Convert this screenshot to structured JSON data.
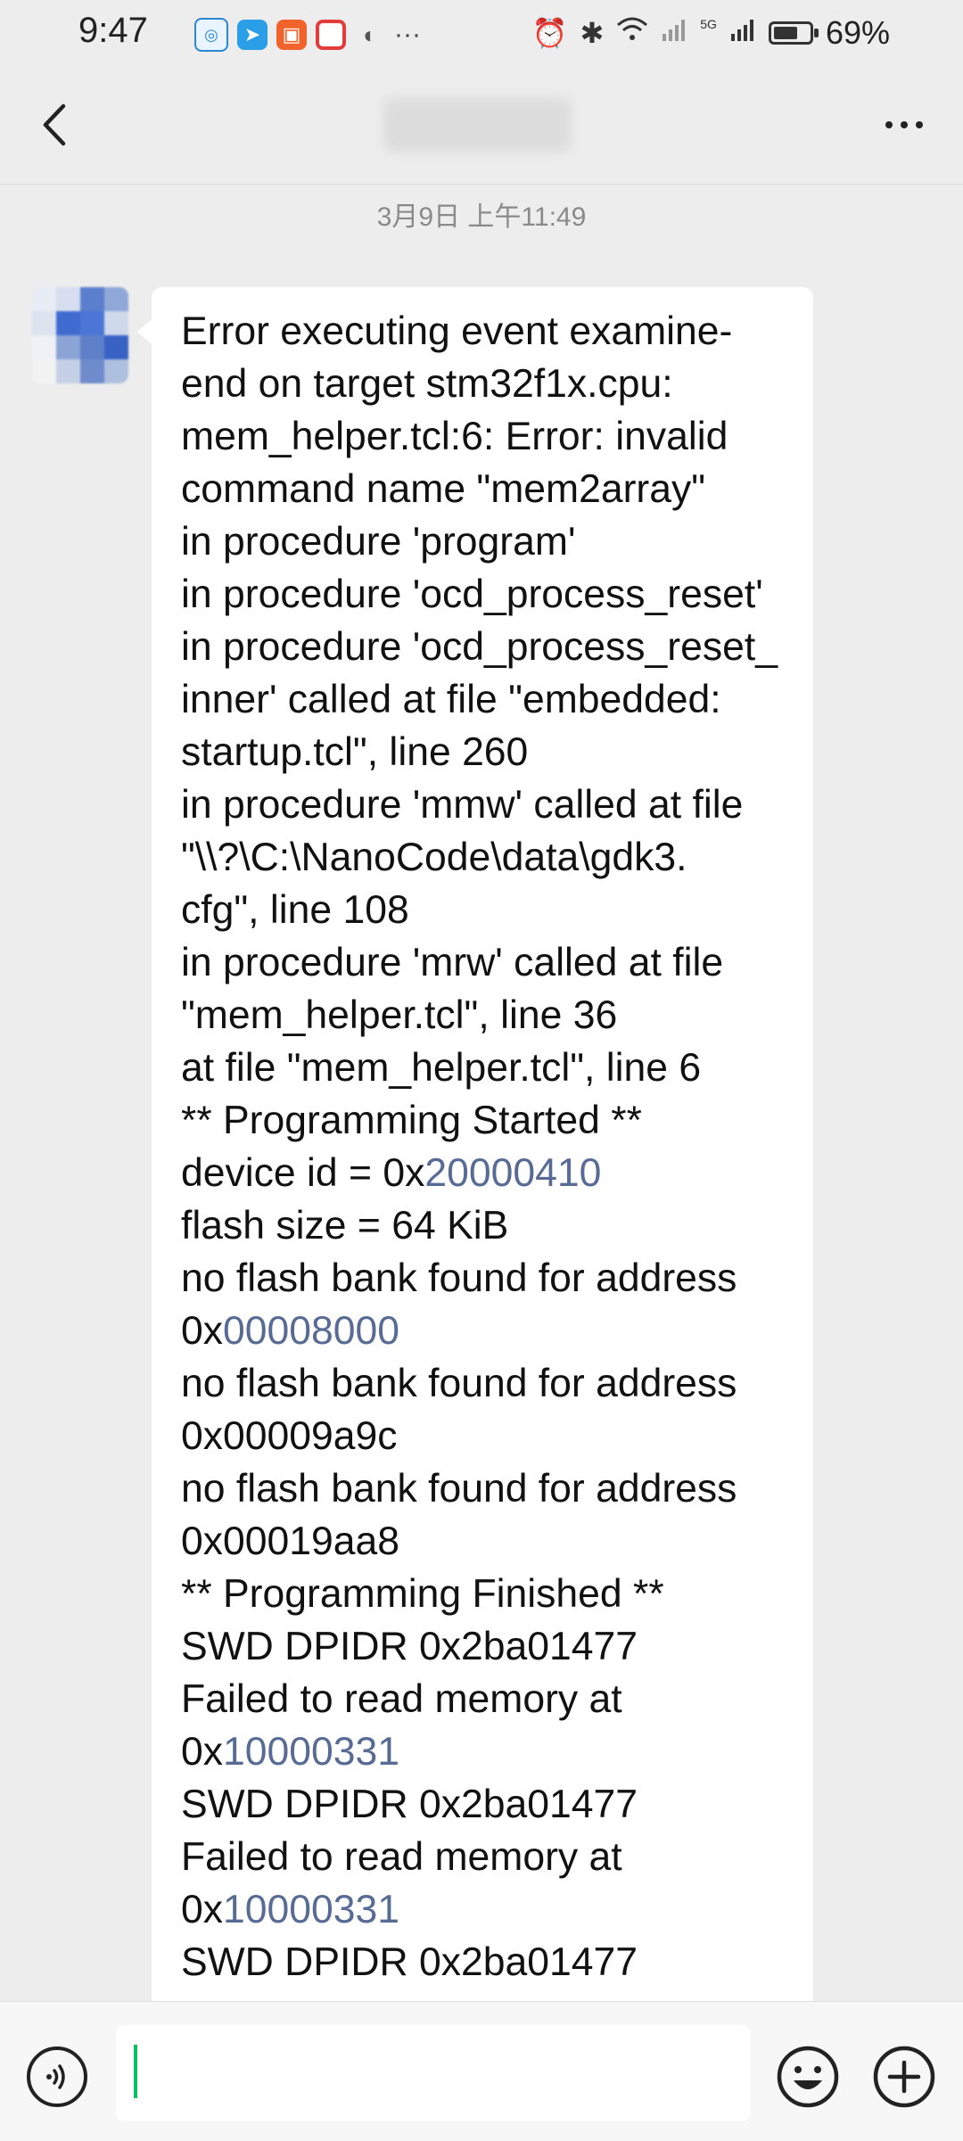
{
  "status_bar": {
    "time": "9:47",
    "notification_icons": [
      "chat-app-icon",
      "telegram-icon",
      "shop-app-icon",
      "red-app-icon",
      "wechat-icon"
    ],
    "overflow": "···",
    "network": "5G",
    "battery_percent": "69%",
    "battery_level": 0.69
  },
  "header": {
    "title": "",
    "back_icon": "back-chevron-icon",
    "more_icon": "more-dots-icon"
  },
  "conversation": {
    "timestamp": "3月9日 上午11:49",
    "message_lines": [
      [
        {
          "t": "Error executing event examine-"
        }
      ],
      [
        {
          "t": "end on target stm32f1x.cpu:"
        }
      ],
      [
        {
          "t": "mem_helper.tcl:6: Error: invalid"
        }
      ],
      [
        {
          "t": "command name \"mem2array\""
        }
      ],
      [
        {
          "t": "in procedure 'program'"
        }
      ],
      [
        {
          "t": "in procedure 'ocd_process_reset'"
        }
      ],
      [
        {
          "t": "in procedure 'ocd_process_reset_"
        }
      ],
      [
        {
          "t": "inner' called at file \"embedded:"
        }
      ],
      [
        {
          "t": "startup.tcl\", line 260"
        }
      ],
      [
        {
          "t": "in procedure 'mmw' called at file"
        }
      ],
      [
        {
          "t": "\"\\\\?\\C:\\NanoCode\\data\\gdk3."
        }
      ],
      [
        {
          "t": "cfg\", line 108"
        }
      ],
      [
        {
          "t": "in procedure 'mrw' called at file"
        }
      ],
      [
        {
          "t": "\"mem_helper.tcl\", line 36"
        }
      ],
      [
        {
          "t": "at file \"mem_helper.tcl\", line 6"
        }
      ],
      [
        {
          "t": "** Programming Started **"
        }
      ],
      [
        {
          "t": "device id = 0x"
        },
        {
          "t": "20000410",
          "link": true
        }
      ],
      [
        {
          "t": "flash size = 64 KiB"
        }
      ],
      [
        {
          "t": "no flash bank found for address"
        }
      ],
      [
        {
          "t": "0x"
        },
        {
          "t": "00008000",
          "link": true
        }
      ],
      [
        {
          "t": "no flash bank found for address"
        }
      ],
      [
        {
          "t": "0x00009a9c"
        }
      ],
      [
        {
          "t": "no flash bank found for address"
        }
      ],
      [
        {
          "t": "0x00019aa8"
        }
      ],
      [
        {
          "t": "** Programming Finished **"
        }
      ],
      [
        {
          "t": "SWD DPIDR 0x2ba01477"
        }
      ],
      [
        {
          "t": "Failed to read memory at"
        }
      ],
      [
        {
          "t": "0x"
        },
        {
          "t": "10000331",
          "link": true
        }
      ],
      [
        {
          "t": "SWD DPIDR 0x2ba01477"
        }
      ],
      [
        {
          "t": "Failed to read memory at"
        }
      ],
      [
        {
          "t": "0x"
        },
        {
          "t": "10000331",
          "link": true
        }
      ],
      [
        {
          "t": "SWD DPIDR 0x2ba01477"
        }
      ]
    ]
  },
  "input_bar": {
    "placeholder": "",
    "voice_icon": "voice-input-icon",
    "emoji_icon": "emoji-icon",
    "plus_icon": "plus-icon"
  },
  "colors": {
    "background": "#ededed",
    "bubble": "#ffffff",
    "link": "#576b95",
    "caret": "#07c160"
  }
}
